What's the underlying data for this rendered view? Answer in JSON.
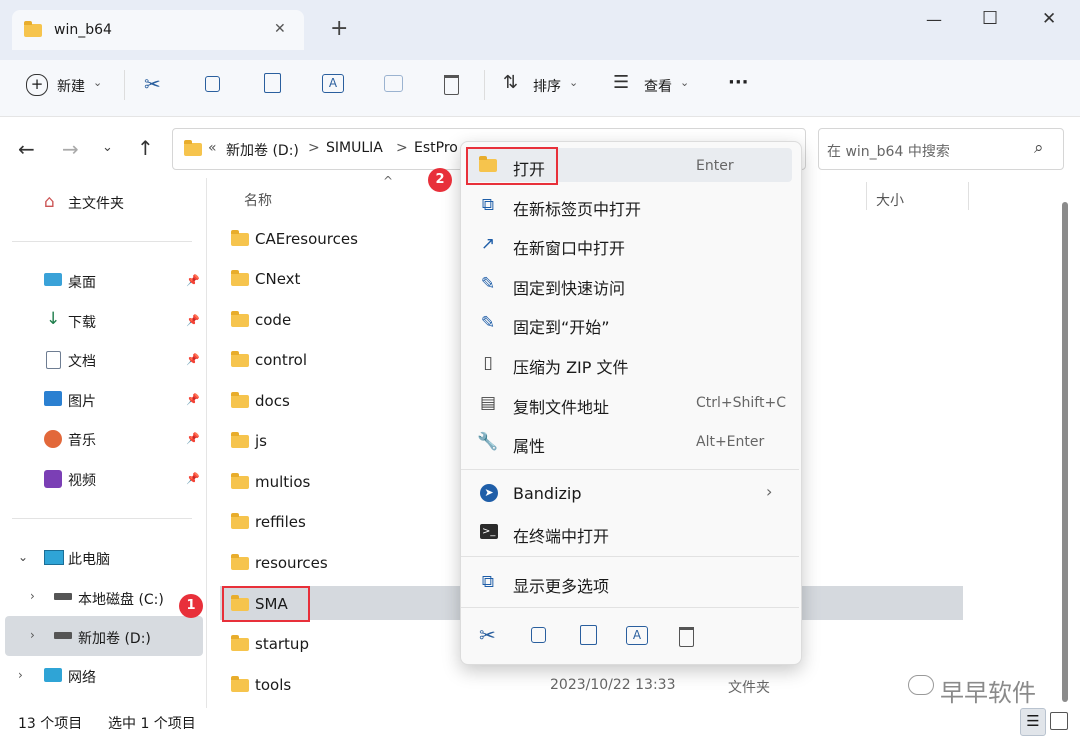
{
  "window": {
    "tab_title": "win_b64",
    "new_tab": "+",
    "close_tab": "✕",
    "minimize": "—",
    "maximize": "☐",
    "close": "✕"
  },
  "toolbar": {
    "new_label": "新建",
    "sort_label": "排序",
    "view_label": "查看",
    "more": "···"
  },
  "address": {
    "crumbs": [
      "«",
      "新加卷 (D:)",
      "SIMULIA",
      "EstPro"
    ],
    "separator": ">",
    "search_placeholder": "在 win_b64 中搜索"
  },
  "columns": {
    "name": "名称",
    "size": "大小"
  },
  "sidebar": {
    "home": "主文件夹",
    "quick": [
      {
        "label": "桌面",
        "icon": "desktop-icon"
      },
      {
        "label": "下载",
        "icon": "download-icon"
      },
      {
        "label": "文档",
        "icon": "document-icon"
      },
      {
        "label": "图片",
        "icon": "pictures-icon"
      },
      {
        "label": "音乐",
        "icon": "music-icon"
      },
      {
        "label": "视频",
        "icon": "video-icon"
      }
    ],
    "this_pc": "此电脑",
    "drives": [
      "本地磁盘 (C:)",
      "新加卷 (D:)"
    ],
    "network": "网络"
  },
  "files": [
    {
      "name": "CAEresources"
    },
    {
      "name": "CNext"
    },
    {
      "name": "code"
    },
    {
      "name": "control"
    },
    {
      "name": "docs"
    },
    {
      "name": "js"
    },
    {
      "name": "multios"
    },
    {
      "name": "reffiles"
    },
    {
      "name": "resources"
    },
    {
      "name": "SMA"
    },
    {
      "name": "startup"
    },
    {
      "name": "tools",
      "date": "2023/10/22 13:33",
      "type": "文件夹"
    }
  ],
  "menu": {
    "items": [
      {
        "label": "打开",
        "shortcut": "Enter",
        "icon": "folder-icon"
      },
      {
        "label": "在新标签页中打开",
        "shortcut": "",
        "icon": "new-tab-icon"
      },
      {
        "label": "在新窗口中打开",
        "shortcut": "",
        "icon": "new-window-icon"
      },
      {
        "label": "固定到快速访问",
        "shortcut": "",
        "icon": "pin-icon"
      },
      {
        "label": "固定到“开始”",
        "shortcut": "",
        "icon": "pin-start-icon"
      },
      {
        "label": "压缩为 ZIP 文件",
        "shortcut": "",
        "icon": "zip-icon"
      },
      {
        "label": "复制文件地址",
        "shortcut": "Ctrl+Shift+C",
        "icon": "copy-path-icon"
      },
      {
        "label": "属性",
        "shortcut": "Alt+Enter",
        "icon": "wrench-icon"
      }
    ],
    "bandizip": "Bandizip",
    "terminal": "在终端中打开",
    "more": "显示更多选项"
  },
  "badges": {
    "one": "1",
    "two": "2"
  },
  "status": {
    "count": "13 个项目",
    "selected": "选中 1 个项目"
  },
  "watermark": "早早软件"
}
